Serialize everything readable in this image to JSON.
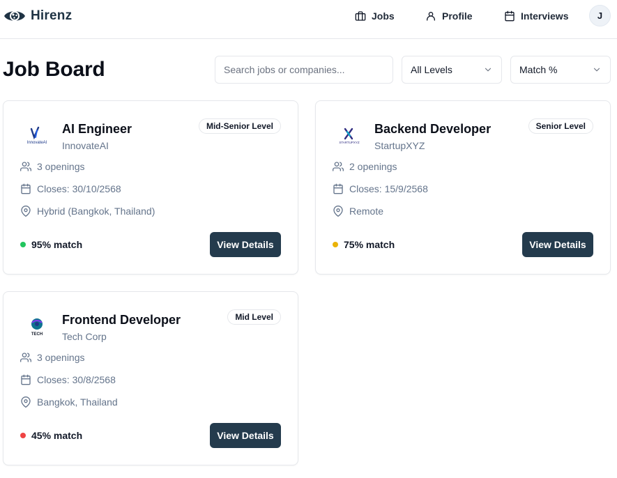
{
  "app": {
    "name": "Hirenz",
    "logo_icon": "eye-logo-icon"
  },
  "nav": {
    "jobs": {
      "label": "Jobs",
      "icon": "briefcase-icon"
    },
    "profile": {
      "label": "Profile",
      "icon": "user-icon"
    },
    "interviews": {
      "label": "Interviews",
      "icon": "calendar-icon"
    },
    "avatar_initial": "J"
  },
  "header": {
    "title": "Job Board",
    "search_placeholder": "Search jobs or companies...",
    "level_filter": {
      "value": "All Levels",
      "icon": "chevron-down-icon"
    },
    "sort_filter": {
      "value": "Match %",
      "icon": "chevron-down-icon"
    }
  },
  "jobs": [
    {
      "title": "AI Engineer",
      "company": "InnovateAI",
      "logo_text": "InnovateAI",
      "level": "Mid-Senior Level",
      "openings": "3 openings",
      "closes": "Closes: 30/10/2568",
      "location": "Hybrid (Bangkok, Thailand)",
      "match": "95% match",
      "match_color": "#22c55e",
      "button": "View Details"
    },
    {
      "title": "Backend Developer",
      "company": "StartupXYZ",
      "logo_text": "STARTUPXYZ",
      "level": "Senior Level",
      "openings": "2 openings",
      "closes": "Closes: 15/9/2568",
      "location": "Remote",
      "match": "75% match",
      "match_color": "#eab308",
      "button": "View Details"
    },
    {
      "title": "Frontend Developer",
      "company": "Tech Corp",
      "logo_text": "TECH",
      "level": "Mid Level",
      "openings": "3 openings",
      "closes": "Closes: 30/8/2568",
      "location": "Bangkok, Thailand",
      "match": "45% match",
      "match_color": "#ef4444",
      "button": "View Details"
    }
  ],
  "colors": {
    "primary_button": "#243b4d",
    "brand_text": "#1f3344",
    "muted_text": "#64748b",
    "border": "#e5e7eb"
  }
}
